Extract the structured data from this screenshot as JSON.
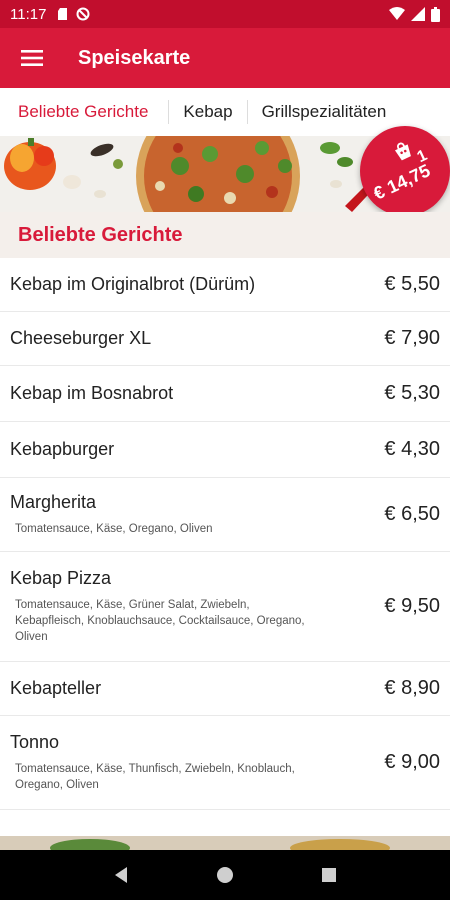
{
  "status_bar": {
    "time": "11:17",
    "icons": [
      "sd-card-icon",
      "do-not-disturb-icon",
      "wifi-icon",
      "signal-icon",
      "battery-icon"
    ]
  },
  "app_bar": {
    "title": "Speisekarte",
    "menu_icon": "hamburger-menu-icon"
  },
  "tabs": [
    {
      "label": "Beliebte Gerichte",
      "active": true
    },
    {
      "label": "Kebap",
      "active": false
    },
    {
      "label": "Grillspezialitäten",
      "active": false
    }
  ],
  "cart": {
    "count": "1",
    "total": "€ 14,75",
    "icon": "shopping-bag-icon"
  },
  "section": {
    "title": "Beliebte Gerichte"
  },
  "items": [
    {
      "name": "Kebap im Originalbrot (Dürüm)",
      "description": "",
      "price": "€ 5,50"
    },
    {
      "name": "Cheeseburger XL",
      "description": "",
      "price": "€ 7,90"
    },
    {
      "name": "Kebap im Bosnabrot",
      "description": "",
      "price": "€ 5,30"
    },
    {
      "name": "Kebapburger",
      "description": "",
      "price": "€ 4,30"
    },
    {
      "name": "Margherita",
      "description": "Tomatensauce, Käse, Oregano, Oliven",
      "price": "€ 6,50"
    },
    {
      "name": "Kebap Pizza",
      "description": "Tomatensauce, Käse, Grüner Salat, Zwiebeln, Kebapfleisch, Knoblauchsauce, Cocktailsauce, Oregano, Oliven",
      "price": "€ 9,50"
    },
    {
      "name": "Kebapteller",
      "description": "",
      "price": "€ 8,90"
    },
    {
      "name": "Tonno",
      "description": "Tomatensauce, Käse, Thunfisch, Zwiebeln, Knoblauch, Oregano, Oliven",
      "price": "€ 9,00"
    }
  ],
  "nav_bar": {
    "icons": [
      "back-icon",
      "home-icon",
      "recents-icon"
    ]
  },
  "colors": {
    "status_bar": "#c10e2d",
    "app_bar": "#d81a3a",
    "accent": "#d81a3a",
    "section_bg": "#f4efeb"
  }
}
